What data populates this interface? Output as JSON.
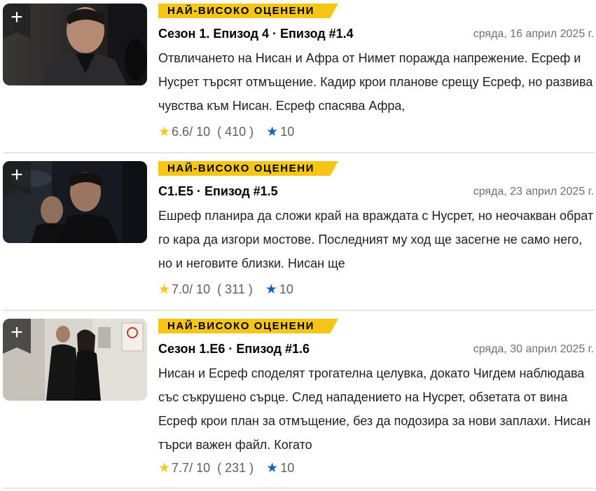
{
  "colors": {
    "accent": "#f5c518",
    "rate_blue": "#1565c0",
    "muted": "#6e6e6e"
  },
  "icons": {
    "watchlist": "plus-icon",
    "rating": "star-icon",
    "user_rating": "star-outline-icon"
  },
  "episodes": [
    {
      "badge": "НАЙ-ВИСОКО ОЦЕНЕНИ",
      "title": "Сезон 1. Епизод 4 · Епизод #1.4",
      "date": "сряда, 16 април 2025 г.",
      "description": "Отвличането на Нисан и Афра от Нимет поражда напрежение. Есреф и Нусрет търсят отмъщение. Кадир крои планове срещу Есреф, но развива чувства към Нисан. Есреф спасява Афра,",
      "rating": "6.6",
      "rating_suffix": "/ 10",
      "votes": "( 410 )",
      "rate_label": "10",
      "watchlist_label": "+"
    },
    {
      "badge": "НАЙ-ВИСОКО ОЦЕНЕНИ",
      "title": "С1.Е5 · Епизод #1.5",
      "date": "сряда, 23 април 2025 г.",
      "description": "Ешреф планира да сложи край на враждата с Нусрет, но неочакван обрат го кара да изгори мостове. Последният му ход ще засегне не само него, но и неговите близки. Нисан ще",
      "rating": "7.0",
      "rating_suffix": "/ 10",
      "votes": "( 311 )",
      "rate_label": "10",
      "watchlist_label": "+"
    },
    {
      "badge": "НАЙ-ВИСОКО ОЦЕНЕНИ",
      "title": "Сезон 1.Е6 · Епизод #1.6",
      "date": "сряда, 30 април 2025 г.",
      "description": "Нисан и Есреф споделят трогателна целувка, докато Чигдем наблюдава със съкрушено сърце. След нападението на Нусрет, обзетата от вина Есреф крои план за отмъщение, без да подозира за нови заплахи. Нисан търси важен файл. Когато",
      "rating": "7.7",
      "rating_suffix": "/ 10",
      "votes": "( 231 )",
      "rate_label": "10",
      "watchlist_label": "+"
    }
  ]
}
